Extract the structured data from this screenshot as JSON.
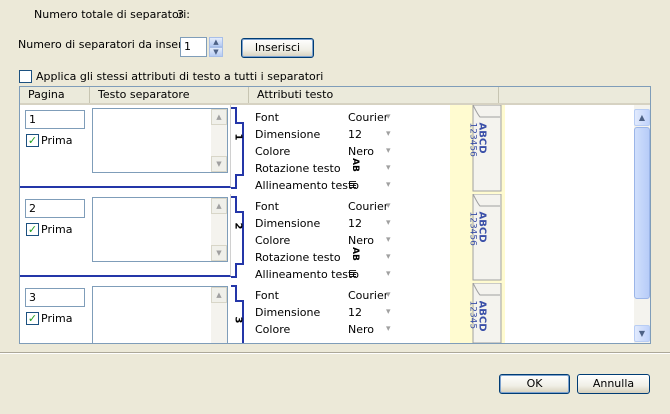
{
  "header": {
    "total_label": "Numero totale di separatori:",
    "total_value": "3",
    "insert_label": "Numero di separatori da inserire:",
    "insert_value": "1",
    "insert_button": "Inserisci",
    "apply_all_label": "Applica gli stessi attributi di testo a tutti i separatori",
    "apply_all_checked": false
  },
  "table": {
    "columns": [
      "Pagina",
      "Testo separatore",
      "Attributi testo"
    ],
    "rows": [
      {
        "page": "1",
        "prima_label": "Prima",
        "prima_checked": true,
        "tab_number": "1",
        "attributes": [
          {
            "label": "Font",
            "value": "Courier"
          },
          {
            "label": "Dimensione",
            "value": "12"
          },
          {
            "label": "Colore",
            "value": "Nero"
          },
          {
            "label": "Rotazione testo",
            "value": "AB"
          },
          {
            "label": "Allineamento testo",
            "value": "≣"
          }
        ],
        "preview_main": "ABCD",
        "preview_sub": "123456"
      },
      {
        "page": "2",
        "prima_label": "Prima",
        "prima_checked": true,
        "tab_number": "2",
        "attributes": [
          {
            "label": "Font",
            "value": "Courier"
          },
          {
            "label": "Dimensione",
            "value": "12"
          },
          {
            "label": "Colore",
            "value": "Nero"
          },
          {
            "label": "Rotazione testo",
            "value": "AB"
          },
          {
            "label": "Allineamento testo",
            "value": "≣"
          }
        ],
        "preview_main": "ABCD",
        "preview_sub": "123456"
      },
      {
        "page": "3",
        "prima_label": "Prima",
        "prima_checked": true,
        "tab_number": "3",
        "attributes": [
          {
            "label": "Font",
            "value": "Courier"
          },
          {
            "label": "Dimensione",
            "value": "12"
          },
          {
            "label": "Colore",
            "value": "Nero"
          }
        ],
        "preview_main": "ABCD",
        "preview_sub": "12345"
      }
    ]
  },
  "footer": {
    "ok_label": "OK",
    "cancel_label": "Annulla"
  },
  "colors": {
    "dialog_bg": "#ece9d8",
    "tab_blue": "#2436a8",
    "preview_bg": "#fffbd0",
    "preview_text": "#3a4fa8"
  }
}
